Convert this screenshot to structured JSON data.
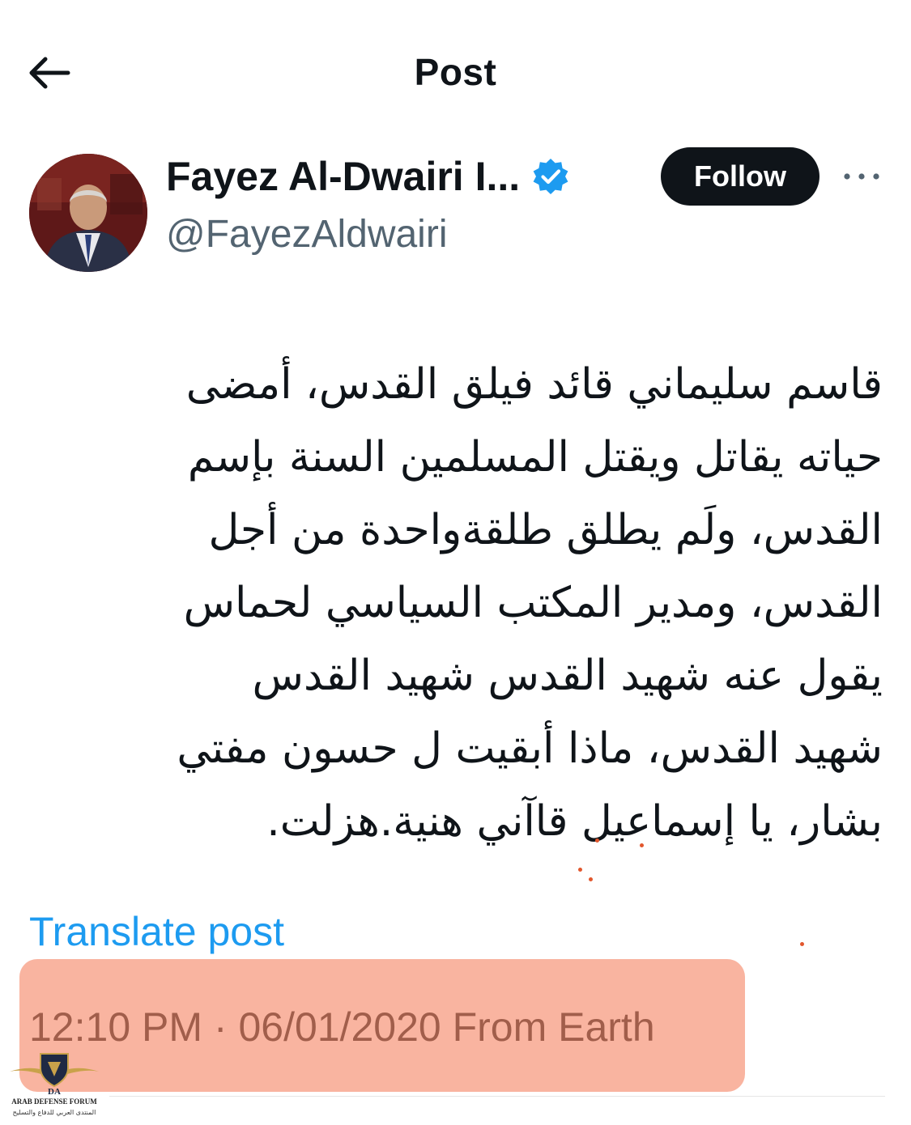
{
  "header": {
    "title": "Post",
    "back_icon": "arrow-left-icon"
  },
  "author": {
    "display_name": "Fayez Al-Dwairi I...",
    "handle": "@FayezAldwairi",
    "verified": true,
    "verified_color": "#1d9bf0"
  },
  "actions": {
    "follow_label": "Follow",
    "more_icon": "more-horizontal-icon"
  },
  "post": {
    "lines": [
      "قاسم سليماني قائد فيلق القدس، أمضى",
      "حياته يقاتل ويقتل المسلمين السنة بإسم",
      "القدس، ولَم يطلق  طلقةواحدة من أجل",
      "القدس، ومدير المكتب السياسي لحماس",
      "يقول عنه شهيد القدس شهيد القدس",
      "شهيد القدس، ماذا أبقيت ل حسون مفتي",
      "بشار، يا إسماعيل قاآني هنية.هزلت."
    ],
    "translate_label": "Translate post",
    "timestamp": "12:10 PM · 06/01/2020 From Earth"
  },
  "watermark": {
    "title": "ARAB DEFENSE FORUM",
    "subtitle": "المنتدى العربي للدفاع والتسليح",
    "badge": "DA"
  },
  "colors": {
    "link": "#1d9bf0",
    "highlight": "#f9b4a0",
    "text": "#0f1419",
    "secondary": "#536471"
  }
}
